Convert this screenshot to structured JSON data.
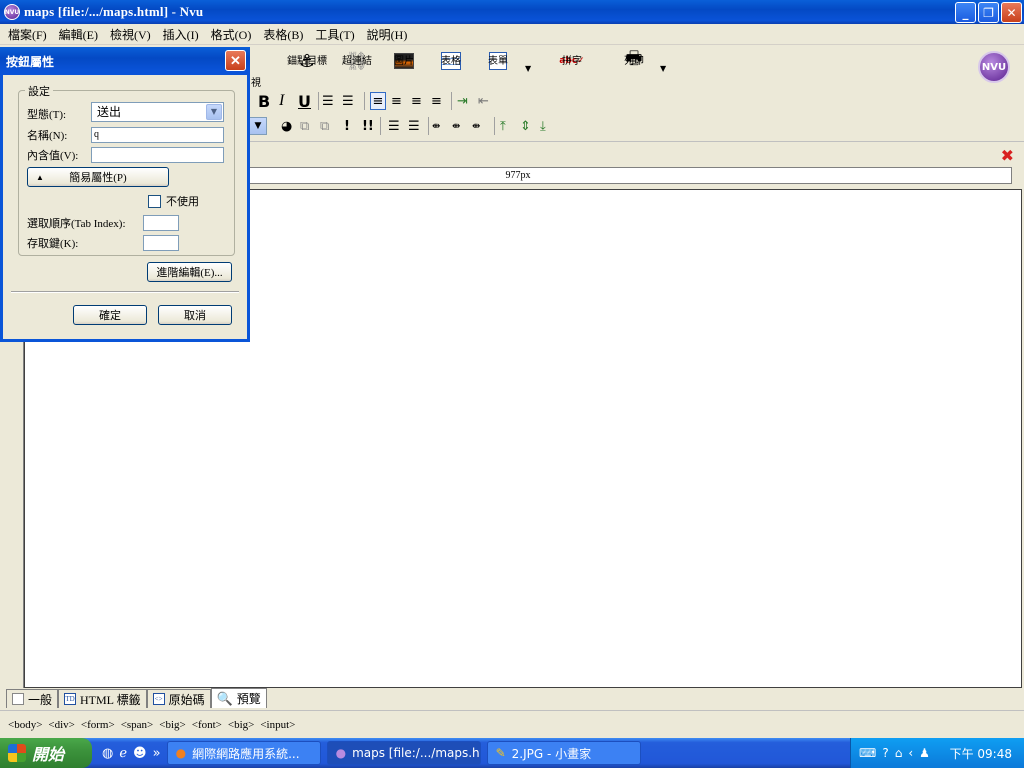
{
  "window": {
    "title": "maps [file:/.../maps.html] - Nvu",
    "app_icon": "NVU"
  },
  "menu": [
    "檔案(F)",
    "編輯(E)",
    "檢視(V)",
    "插入(I)",
    "格式(O)",
    "表格(B)",
    "工具(T)",
    "說明(H)"
  ],
  "toolbar": {
    "partial_label": "視",
    "anchor": "錨點目標",
    "link": "超連結",
    "image": "圖片",
    "table": "表格",
    "form": "表單",
    "spell": "拼字",
    "print": "列印",
    "logo": "NVU"
  },
  "ruler": {
    "width_label": "977px"
  },
  "bottom_tabs": {
    "normal": "一般",
    "html_tags": "HTML 標籤",
    "source": "原始碼",
    "preview": "預覽"
  },
  "status": [
    "<body>",
    "<div>",
    "<form>",
    "<span>",
    "<big>",
    "<font>",
    "<big>",
    "<input>"
  ],
  "taskbar": {
    "start": "開始",
    "tasks": [
      "網際網路應用系統...",
      "maps [file:/.../maps.ht...",
      "2.JPG - 小畫家"
    ],
    "clock": "下午 09:48"
  },
  "dialog": {
    "title": "按鈕屬性",
    "group_title": "設定",
    "type_label": "型態(T):",
    "type_value": "送出",
    "name_label": "名稱(N):",
    "name_value": "q",
    "value_label": "內含值(V):",
    "value_value": "",
    "simple_props": "簡易屬性(P)",
    "disabled_label": "不使用",
    "tabindex_label": "選取順序(Tab Index):",
    "accesskey_label": "存取鍵(K):",
    "advanced": "進階編輯(E)...",
    "ok": "確定",
    "cancel": "取消"
  }
}
